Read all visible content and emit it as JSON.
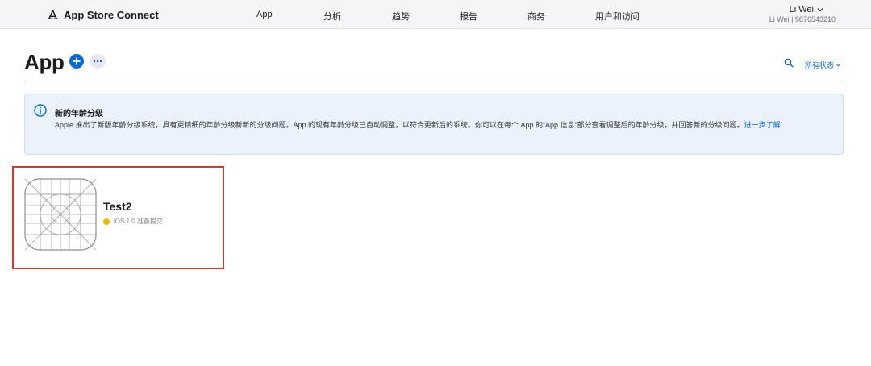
{
  "topbar": {
    "brand": "App Store Connect",
    "brand_icon": "app-store-icon",
    "nav": [
      {
        "label": "App"
      },
      {
        "label": "分析"
      },
      {
        "label": "趋势"
      },
      {
        "label": "报告"
      },
      {
        "label": "商务"
      },
      {
        "label": "用户和访问"
      }
    ],
    "user_name": "Li Wei",
    "user_sub": "Li Wei | 9876543210"
  },
  "header": {
    "title": "App",
    "add_icon": "plus-icon",
    "more_icon": "ellipsis-icon",
    "search_icon": "search-icon",
    "filter_label": "所有状态"
  },
  "banner": {
    "title": "新的年龄分级",
    "body": "Apple 推出了新版年龄分级系统，具有更精细的年龄分级新新的分级问题。App 的现有年龄分级已自动调整，以符合更新后的系统。你可以在每个 App 的“App 信息”部分查看调整后的年龄分级，并回答新的分级问题。",
    "link": "进一步了解",
    "icon": "info-icon"
  },
  "apps": [
    {
      "name": "Test2",
      "status": "iOS 1.0 准备提交",
      "status_color": "#f5b800"
    }
  ],
  "colors": {
    "accent": "#0a66d8",
    "highlight": "#d23a2a",
    "banner_bg": "#eaf3fc"
  }
}
